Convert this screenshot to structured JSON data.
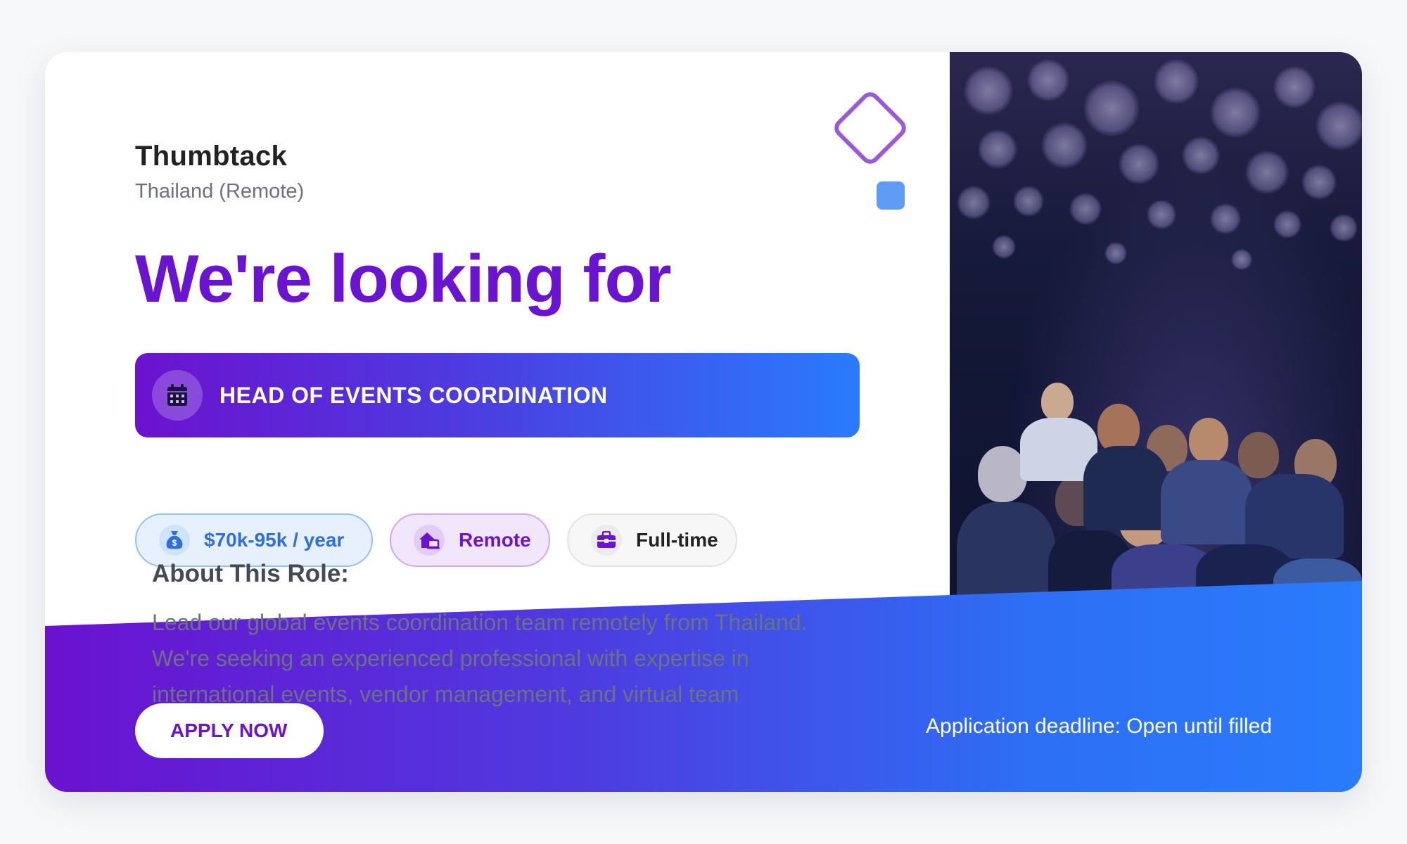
{
  "company": {
    "name": "Thumbtack",
    "location": "Thailand (Remote)"
  },
  "headline": "We're looking for",
  "job": {
    "title": "HEAD OF EVENTS COORDINATION",
    "icon": "calendar-icon"
  },
  "tags": [
    {
      "label": "$70k-95k / year",
      "icon": "money-bag-icon",
      "color": "#2f6fe0"
    },
    {
      "label": "Remote",
      "icon": "home-office-icon",
      "color": "#6a14d1"
    },
    {
      "label": "Full-time",
      "icon": "briefcase-icon",
      "color": "#6a14d1"
    }
  ],
  "about": {
    "title": "About This Role:",
    "text": "Lead our global events coordination team remotely from Thailand. We're seeking an experienced professional with expertise in international events, vendor management, and virtual team leadership."
  },
  "cta": {
    "apply_label": "APPLY NOW",
    "deadline": "Application deadline: Open until filled"
  },
  "colors": {
    "brand_purple": "#6a14d1",
    "brand_blue": "#2a7bfd",
    "accent_blue": "#5f9cf6",
    "diamond_outline": "#9b59d8"
  }
}
